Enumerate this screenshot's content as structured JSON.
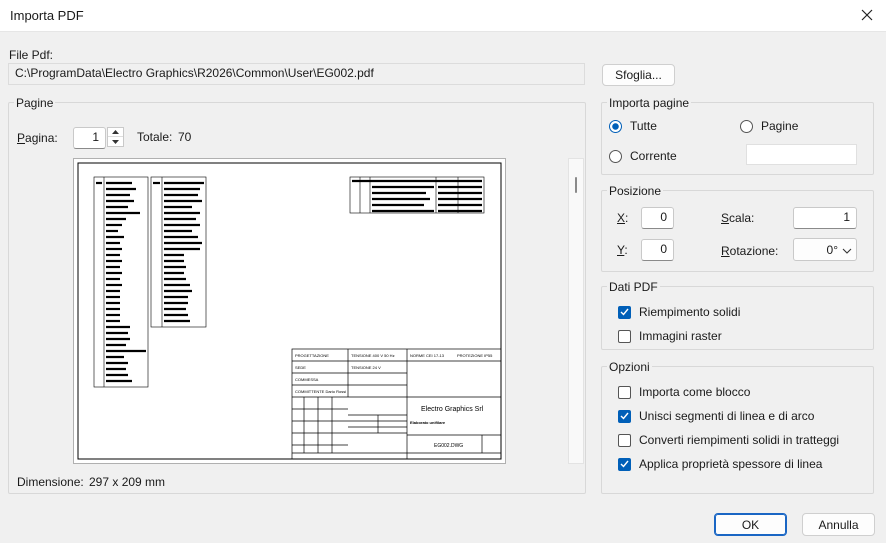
{
  "window": {
    "title": "Importa PDF"
  },
  "file": {
    "label": "File Pdf:",
    "path": "C:\\ProgramData\\Electro Graphics\\R2026\\Common\\User\\EG002.pdf",
    "browse_label": "Sfoglia..."
  },
  "pages": {
    "group_title": "Pagine",
    "page_label": "Pagina:",
    "page_value": "1",
    "total_label": "Totale:",
    "total_value": "70",
    "dimension_label": "Dimensione:",
    "dimension_value": "297 x 209 mm",
    "preview": {
      "company": "Electro Graphics Srl",
      "drawing": "EG002.DWG",
      "subtitle": "Elaborato unifilare"
    }
  },
  "import_pages": {
    "group_title": "Importa pagine",
    "options": [
      "Tutte",
      "Pagine",
      "Corrente"
    ],
    "selected": "Tutte"
  },
  "position": {
    "group_title": "Posizione",
    "x_label": "X:",
    "x_value": "0",
    "y_label": "Y:",
    "y_value": "0",
    "scale_label": "Scala:",
    "scale_value": "1",
    "rotation_label": "Rotazione:",
    "rotation_value": "0°"
  },
  "pdf_data": {
    "group_title": "Dati PDF",
    "items": [
      {
        "label": "Riempimento solidi",
        "checked": true
      },
      {
        "label": "Immagini raster",
        "checked": false
      }
    ]
  },
  "options": {
    "group_title": "Opzioni",
    "items": [
      {
        "label": "Importa come blocco",
        "checked": false
      },
      {
        "label": "Unisci segmenti di linea e di arco",
        "checked": true
      },
      {
        "label": "Converti riempimenti solidi in tratteggi",
        "checked": false
      },
      {
        "label": "Applica proprietà spessore di linea",
        "checked": true
      }
    ]
  },
  "buttons": {
    "ok": "OK",
    "cancel": "Annulla"
  },
  "colors": {
    "accent": "#005fb8",
    "window_bg": "#f0f0f0"
  }
}
